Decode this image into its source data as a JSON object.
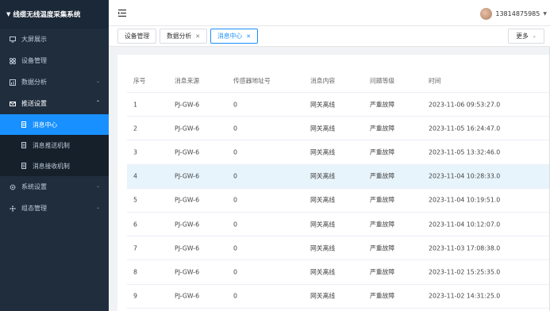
{
  "app": {
    "title": "线缆无线温度采集系统"
  },
  "sidebar": {
    "items": [
      {
        "label": "大屏展示",
        "icon": "monitor-icon"
      },
      {
        "label": "设备管理",
        "icon": "grid-icon"
      },
      {
        "label": "数据分析",
        "icon": "chart-icon",
        "has_children": true
      },
      {
        "label": "推送设置",
        "icon": "mail-icon",
        "has_children": true,
        "open": true,
        "children": [
          {
            "label": "消息中心",
            "active": true
          },
          {
            "label": "消息推送机制"
          },
          {
            "label": "消息接收机制"
          }
        ]
      },
      {
        "label": "系统设置",
        "icon": "gear-icon",
        "has_children": true
      },
      {
        "label": "组态管理",
        "icon": "config-icon",
        "has_children": true
      }
    ]
  },
  "header": {
    "username": "13814875985"
  },
  "tabs": [
    {
      "label": "设备管理",
      "closable": false
    },
    {
      "label": "数据分析",
      "closable": true
    },
    {
      "label": "消息中心",
      "closable": true,
      "active": true
    }
  ],
  "more_label": "更多",
  "table": {
    "columns": [
      "序号",
      "消息来源",
      "传感器地址号",
      "消息内容",
      "问题等级",
      "时间"
    ],
    "rows": [
      [
        "1",
        "PJ-GW-6",
        "0",
        "网关离线",
        "严重故障",
        "2023-11-06 09:53:27.0"
      ],
      [
        "2",
        "PJ-GW-6",
        "0",
        "网关离线",
        "严重故障",
        "2023-11-05 16:24:47.0"
      ],
      [
        "3",
        "PJ-GW-6",
        "0",
        "网关离线",
        "严重故障",
        "2023-11-05 13:32:46.0"
      ],
      [
        "4",
        "PJ-GW-6",
        "0",
        "网关离线",
        "严重故障",
        "2023-11-04 10:28:33.0"
      ],
      [
        "5",
        "PJ-GW-6",
        "0",
        "网关离线",
        "严重故障",
        "2023-11-04 10:19:51.0"
      ],
      [
        "6",
        "PJ-GW-6",
        "0",
        "网关离线",
        "严重故障",
        "2023-11-04 10:12:07.0"
      ],
      [
        "7",
        "PJ-GW-6",
        "0",
        "网关离线",
        "严重故障",
        "2023-11-03 17:08:38.0"
      ],
      [
        "8",
        "PJ-GW-6",
        "0",
        "网关离线",
        "严重故障",
        "2023-11-02 15:25:35.0"
      ],
      [
        "9",
        "PJ-GW-6",
        "0",
        "网关离线",
        "严重故障",
        "2023-11-02 14:31:25.0"
      ]
    ],
    "highlighted_row": 3
  }
}
